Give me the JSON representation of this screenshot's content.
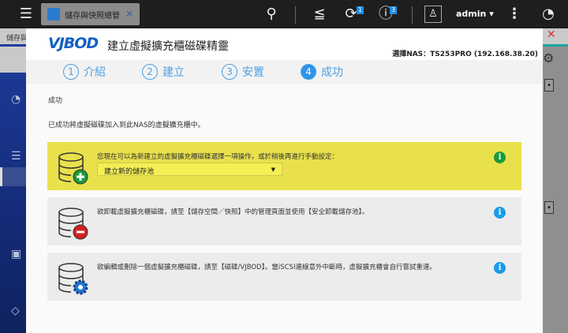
{
  "topbar": {
    "tab_label": "儲存與快照總管",
    "tab_close": "×",
    "notification_count": "1",
    "info_count": "3",
    "user": "admin"
  },
  "subbar": {
    "title": "儲存與"
  },
  "dialog": {
    "logo": "VJBOD",
    "title": "建立虛擬擴充櫃磁碟精靈",
    "nas": "選擇NAS：TS253PRO (192.168.38.20)",
    "steps": [
      {
        "num": "1",
        "label": "介紹"
      },
      {
        "num": "2",
        "label": "建立"
      },
      {
        "num": "3",
        "label": "安置"
      },
      {
        "num": "4",
        "label": "成功"
      }
    ],
    "section": "成功",
    "message": "已成功將虛擬磁碟加入到此NAS的虛擬擴充櫃中。",
    "cards": [
      {
        "text": "您現在可以為新建立的虛擬擴充櫃磁碟選擇一項操作，或於稍後再進行手動設定：",
        "select": "建立新的儲存池"
      },
      {
        "text": "欲卸載虛擬擴充櫃磁碟，請至【儲存空間／快照】中的管理頁面並使用【安全卸載儲存池】。"
      },
      {
        "text": "欲編輯或刪除一個虛擬擴充櫃磁碟，請至【磁碟/VJBOD】。當iSCSI連線意外中斷時，虛擬擴充櫃會自行嘗試重連。"
      }
    ]
  },
  "colors": {
    "accent": "#2d94ea",
    "highlight": "#e8e14c",
    "success": "#1a9a3a",
    "danger": "#d42020"
  }
}
